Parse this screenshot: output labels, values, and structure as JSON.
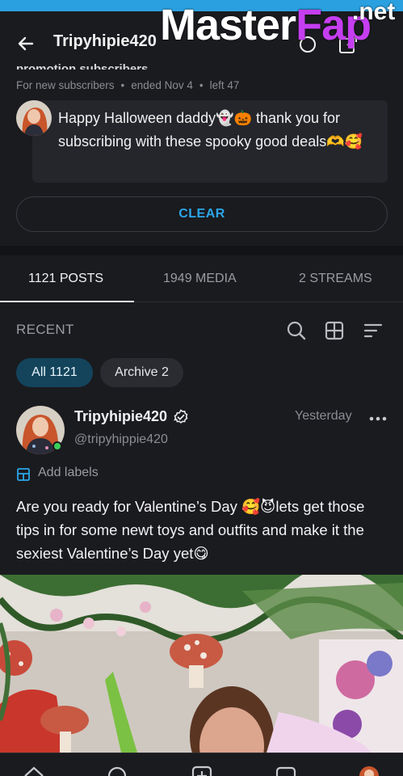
{
  "header": {
    "title": "Tripyhipie420",
    "back_icon": "arrow-left-icon",
    "watermark_main": "Master",
    "watermark_accent": "Fap",
    "watermark_net": ".net"
  },
  "promo": {
    "title": "promotion subscribers",
    "audience": "For new subscribers",
    "ended": "ended Nov 4",
    "left": "left 47",
    "message": "Happy Halloween daddy👻🎃 thank you for subscribing with these spooky good deals🫶🥰",
    "clear_label": "CLEAR"
  },
  "tabs": [
    {
      "label": "1121 POSTS",
      "active": true
    },
    {
      "label": "1949 MEDIA",
      "active": false
    },
    {
      "label": "2 STREAMS",
      "active": false
    }
  ],
  "toolbar": {
    "recent_label": "RECENT",
    "icons": [
      "search-icon",
      "grid-icon",
      "sort-icon"
    ]
  },
  "filters": [
    {
      "label": "All 1121",
      "active": true
    },
    {
      "label": "Archive 2",
      "active": false
    }
  ],
  "post": {
    "author": "Tripyhipie420",
    "handle": "@tripyhippie420",
    "time": "Yesterday",
    "labels_action": "Add labels",
    "text": "Are you ready for Valentine’s Day 🥰😈lets get those tips in for some newt toys and outfits and make it the sexiest Valentine’s Day yet😋"
  },
  "bottom_nav": [
    "home-icon",
    "search-icon",
    "add-post-icon",
    "messages-icon",
    "profile-avatar"
  ],
  "colors": {
    "background": "#1a1b1f",
    "accent": "#2aa7e9",
    "chip_active": "#13445c",
    "online": "#3ccf5a"
  }
}
